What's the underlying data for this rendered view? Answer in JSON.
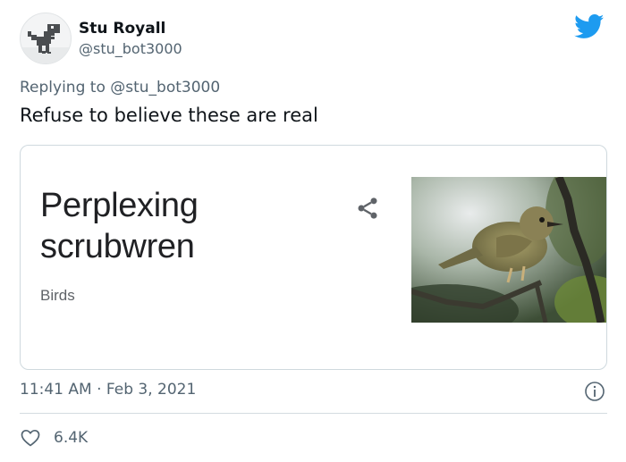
{
  "author": {
    "display_name": "Stu Royall",
    "handle": "@stu_bot3000",
    "avatar_icon": "pixel-dinosaur-icon"
  },
  "reply": {
    "prefix": "Replying to",
    "mention": "@stu_bot3000"
  },
  "tweet": {
    "text": "Refuse to believe these are real"
  },
  "card": {
    "title_line1": "Perplexing",
    "title_line2": "scrubwren",
    "category": "Birds",
    "share_icon": "share-icon",
    "image": "bird-on-branch-photo"
  },
  "meta": {
    "time": "11:41 AM",
    "separator": "·",
    "date": "Feb 3, 2021"
  },
  "actions": {
    "likes": "6.4K"
  },
  "colors": {
    "twitter_blue": "#1d9bf0",
    "text_primary": "#0f1419",
    "text_secondary": "#536471",
    "border": "#cfd9de"
  }
}
